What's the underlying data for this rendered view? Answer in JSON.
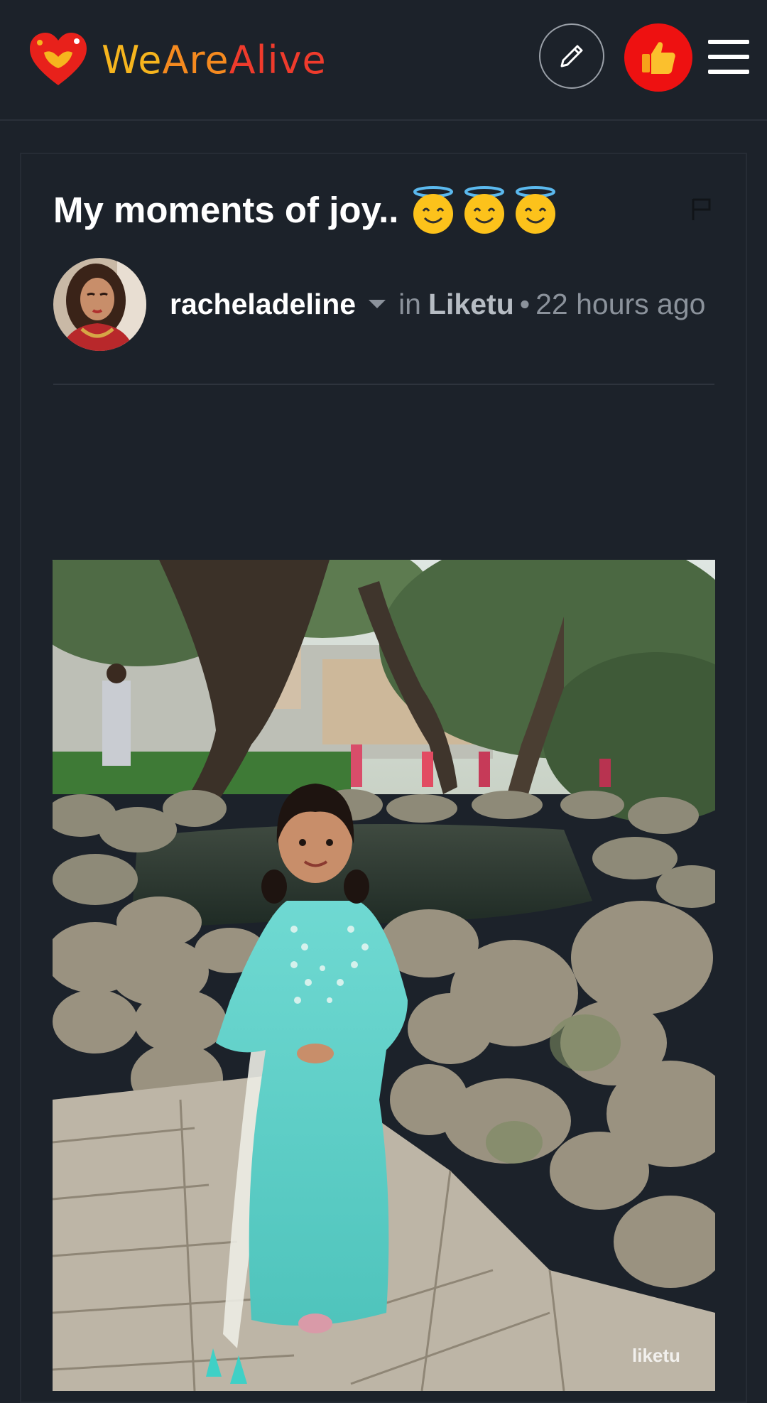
{
  "header": {
    "logo_part1": "We",
    "logo_part2": "Are",
    "logo_part3": "Alive",
    "logo_icon": "heart-hands-icon",
    "edit_icon": "pencil-icon",
    "like_icon": "thumbs-up-icon",
    "menu_icon": "hamburger-menu-icon"
  },
  "post": {
    "title": "My moments of joy..",
    "title_emojis": [
      "😇",
      "😇",
      "😇"
    ],
    "author": "racheladeline",
    "in_label": "in",
    "community": "Liketu",
    "separator": "•",
    "time": "22 hours ago",
    "flag_icon": "flag-icon"
  },
  "image": {
    "watermark": "liketu"
  },
  "colors": {
    "background": "#1c222a",
    "like_red": "#ee1111",
    "logo_yellow": "#f6b51e",
    "logo_orange": "#f58a1f",
    "logo_red": "#ef3b2c"
  }
}
